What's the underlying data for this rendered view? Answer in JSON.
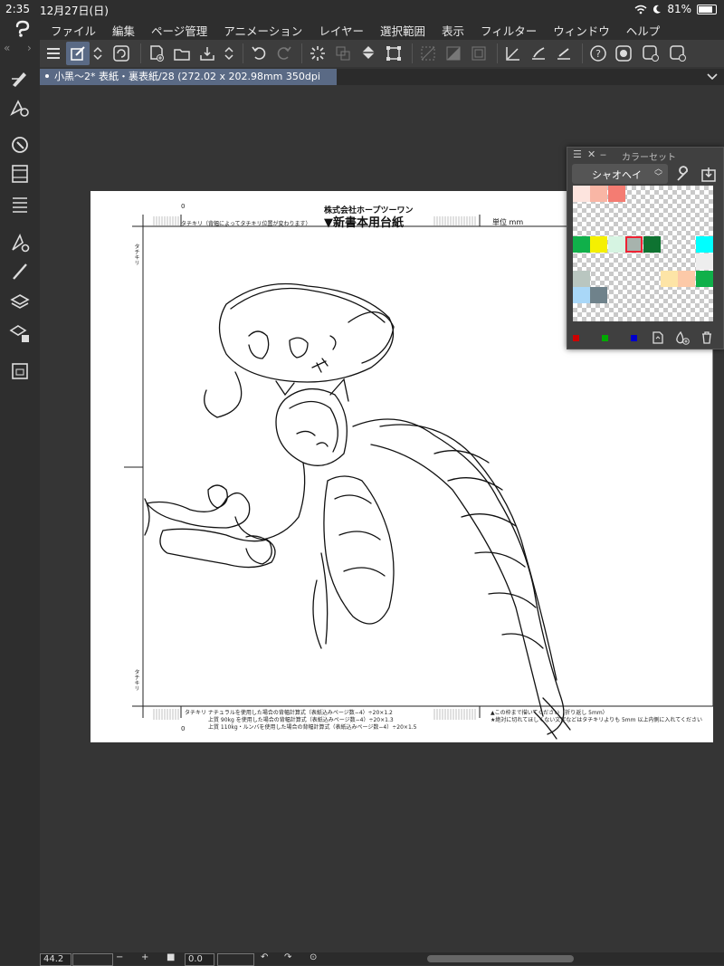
{
  "status": {
    "time": "2:35",
    "date": "12月27日(日)",
    "battery": "81%",
    "battery_level": 0.81
  },
  "menu": [
    "ファイル",
    "編集",
    "ページ管理",
    "アニメーション",
    "レイヤー",
    "選択範囲",
    "表示",
    "フィルター",
    "ウィンドウ",
    "ヘルプ"
  ],
  "tab": {
    "title": "小黑～2* 表紙・裏表紙/28 (272.02 x 202.98mm 350dpi 44.2%)"
  },
  "paper": {
    "company": "株式会社ホープツーワン",
    "title": "▼新書本用台紙",
    "unit": "単位 mm",
    "top_note": "タチキリ（背幅によってタチキリ位置が変わります）",
    "side_label_top": "タチキリ",
    "side_label_bottom": "タチキリ",
    "ruler_top": "0",
    "ruler_bottom": "0",
    "bottom_lines": [
      "タチキリ ナチュラルを使用した場合の背幅計算式（表紙込みページ数−4）÷20×1.2",
      "上質 90kg を使用した場合の背幅計算式（表紙込みページ数−4）÷20×1.3",
      "上質 110kg・ルンバを使用した場合の背幅計算式（表紙込みページ数−4）÷20×1.5"
    ],
    "bottom_right_lines": [
      "▲この枠まで描いてください（折り返し 5mm）",
      "★絶対に切れてほしくない文字などはタチキリよりも 5mm 以上内側に入れてください"
    ]
  },
  "palette": {
    "title": "カラーセット",
    "set_name": "シャオヘイ",
    "colors": [
      {
        "row": 0,
        "col": 0,
        "hex": "#fde4de"
      },
      {
        "row": 0,
        "col": 1,
        "hex": "#f9b6a5"
      },
      {
        "row": 0,
        "col": 2,
        "hex": "#f47c72"
      },
      {
        "row": 3,
        "col": 0,
        "hex": "#10b04a"
      },
      {
        "row": 3,
        "col": 1,
        "hex": "#f5f000"
      },
      {
        "row": 3,
        "col": 2,
        "hex": "#d6f4e2"
      },
      {
        "row": 3,
        "col": 3,
        "hex": "#a7b3ad",
        "selected": true
      },
      {
        "row": 3,
        "col": 4,
        "hex": "#0e7331"
      },
      {
        "row": 3,
        "col": 7,
        "hex": "#00ffff"
      },
      {
        "row": 4,
        "col": 7,
        "hex": "#eeeeee"
      },
      {
        "row": 5,
        "col": 0,
        "hex": "#b9c6c0"
      },
      {
        "row": 5,
        "col": 5,
        "hex": "#fde4a6"
      },
      {
        "row": 5,
        "col": 6,
        "hex": "#fcc9a8"
      },
      {
        "row": 5,
        "col": 7,
        "hex": "#10b04a"
      },
      {
        "row": 6,
        "col": 0,
        "hex": "#a9d7f7"
      },
      {
        "row": 6,
        "col": 1,
        "hex": "#6f828b"
      }
    ],
    "footer_swatches": [
      "#cc0000",
      "#00aa00",
      "#0000cc"
    ]
  },
  "bottom": {
    "zoom": "44.2",
    "rotation": "0.0"
  }
}
